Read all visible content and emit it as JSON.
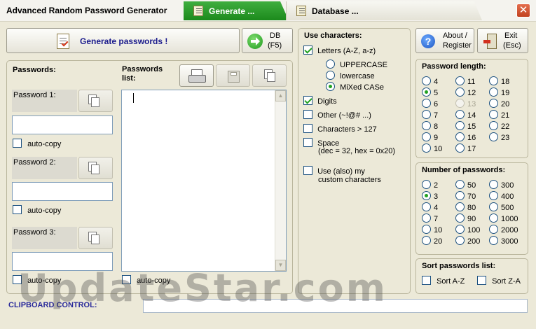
{
  "window": {
    "title": "Advanced Random Password Generator"
  },
  "tabs": [
    {
      "label": "Generate ...",
      "active": true
    },
    {
      "label": "Database ...",
      "active": false
    }
  ],
  "toolbar": {
    "generate_label": "Generate passwords !",
    "db_label_1": "DB",
    "db_label_2": "(F5)",
    "about_label_1": "About /",
    "about_label_2": "Register",
    "exit_label_1": "Exit",
    "exit_label_2": "(Esc)"
  },
  "passwords": {
    "heading": "Passwords:",
    "list_heading_1": "Passwords",
    "list_heading_2": "list:",
    "items": [
      {
        "label": "Password 1:",
        "value": "",
        "autocopy_label": "auto-copy",
        "autocopy": false
      },
      {
        "label": "Password 2:",
        "value": "",
        "autocopy_label": "auto-copy",
        "autocopy": false
      },
      {
        "label": "Password 3:",
        "value": "",
        "autocopy_label": "auto-copy",
        "autocopy": false
      }
    ],
    "list_autocopy_label": "auto-copy",
    "list_value": ""
  },
  "characters": {
    "heading": "Use characters:",
    "letters_label": "Letters (A-Z, a-z)",
    "letters_checked": true,
    "case_options": [
      "UPPERCASE",
      "lowercase",
      "MiXed CASe"
    ],
    "case_selected": "MiXed CASe",
    "digits_label": "Digits",
    "digits_checked": true,
    "other_label": "Other (~!@# ...)",
    "other_checked": false,
    "gt127_label": "Characters > 127",
    "gt127_checked": false,
    "space_label_1": "Space",
    "space_label_2": "(dec = 32, hex = 0x20)",
    "space_checked": false,
    "custom_label_1": "Use (also) my",
    "custom_label_2": "custom characters",
    "custom_checked": false
  },
  "length": {
    "heading": "Password length:",
    "options": [
      "4",
      "5",
      "6",
      "7",
      "8",
      "9",
      "10",
      "11",
      "12",
      "13",
      "14",
      "15",
      "16",
      "17",
      "18",
      "19",
      "20",
      "21",
      "22",
      "23"
    ],
    "selected": "5",
    "disabled": "13"
  },
  "count": {
    "heading": "Number of passwords:",
    "options": [
      "2",
      "3",
      "4",
      "7",
      "10",
      "20",
      "50",
      "70",
      "80",
      "90",
      "100",
      "200",
      "300",
      "400",
      "500",
      "1000",
      "2000",
      "3000"
    ],
    "selected": "3"
  },
  "sort": {
    "heading": "Sort passwords list:",
    "az_label": "Sort A-Z",
    "za_label": "Sort Z-A"
  },
  "clipboard": {
    "label": "CLIPBOARD CONTROL:",
    "value": ""
  },
  "watermark": "UpdateStar.com",
  "colors": {
    "accent_green": "#21a121",
    "clipboard_label": "#2a2a9a",
    "generate_text": "#1a1a8c"
  }
}
